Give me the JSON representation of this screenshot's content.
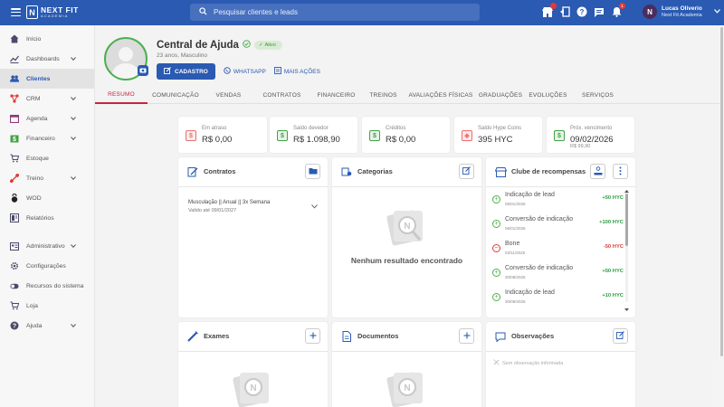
{
  "topbar": {
    "brand_line1": "NEXT FIT",
    "brand_line2": "ACADEMIA",
    "search_placeholder": "Pesquisar clientes e leads",
    "icons": [
      "store-icon",
      "exit-door-icon",
      "help-icon",
      "chat-icon",
      "bell-icon"
    ],
    "notification_badge": "1",
    "user_initial": "N",
    "user_name": "Lucas Oliverio",
    "user_company": "Next Fit Academia",
    "brand_color": "#2a5ab1"
  },
  "sidebar": {
    "items": [
      {
        "label": "Início",
        "icon": "home-icon",
        "chevron": false,
        "active": false
      },
      {
        "label": "Dashboards",
        "icon": "chart-line-icon",
        "chevron": true,
        "active": false
      },
      {
        "label": "Clientes",
        "icon": "people-icon",
        "chevron": false,
        "active": true
      },
      {
        "label": "CRM",
        "icon": "crm-icon",
        "chevron": true,
        "active": false
      },
      {
        "label": "Agenda",
        "icon": "calendar-icon",
        "chevron": true,
        "active": false
      },
      {
        "label": "Financeiro",
        "icon": "money-icon",
        "chevron": true,
        "active": false
      },
      {
        "label": "Estoque",
        "icon": "cart-icon",
        "chevron": false,
        "active": false
      },
      {
        "label": "Treino",
        "icon": "dumbbell-icon",
        "chevron": true,
        "active": false
      },
      {
        "label": "WOD",
        "icon": "kettlebell-icon",
        "chevron": false,
        "active": false
      },
      {
        "label": "Relatórios",
        "icon": "report-icon",
        "chevron": false,
        "active": false
      }
    ],
    "items2": [
      {
        "label": "Administrativo",
        "icon": "id-card-icon",
        "chevron": true
      },
      {
        "label": "Configurações",
        "icon": "gear-icon",
        "chevron": false
      },
      {
        "label": "Recursos do sistema",
        "icon": "toggle-icon",
        "chevron": false
      },
      {
        "label": "Loja",
        "icon": "cart-icon",
        "chevron": false
      },
      {
        "label": "Ajuda",
        "icon": "help-icon",
        "chevron": true
      }
    ]
  },
  "profile": {
    "name": "Central de Ajuda",
    "status": "Ativo",
    "subtitle": "23 anos, Masculino",
    "cadastro_label": "CADASTRO",
    "whatsapp_label": "WHATSAPP",
    "more_label": "MAIS AÇÕES"
  },
  "tabs": [
    "RESUMO",
    "COMUNICAÇÃO",
    "VENDAS",
    "CONTRATOS",
    "FINANCEIRO",
    "TREINOS",
    "AVALIAÇÕES FÍSICAS",
    "GRADUAÇÕES",
    "EVOLUÇÕES",
    "SERVIÇOS"
  ],
  "summary": [
    {
      "label": "Em atraso",
      "value": "R$ 0,00",
      "extra": "",
      "color": "#e57373",
      "bg": "#fdeaea"
    },
    {
      "label": "Saldo devedor",
      "value": "R$ 1.098,90",
      "extra": "",
      "color": "#43a047",
      "bg": "#e6f4e7"
    },
    {
      "label": "Créditos",
      "value": "R$ 0,00",
      "extra": "",
      "color": "#43a047",
      "bg": "#e6f4e7"
    },
    {
      "label": "Saldo Hype Coins",
      "value": "395 HYC",
      "extra": "",
      "color": "#ef6c6c",
      "bg": "#fde9e9"
    },
    {
      "label": "Próx. vencimento",
      "value": "09/02/2026",
      "extra": "R$ 99,90",
      "color": "#43a047",
      "bg": "#e6f4e7"
    }
  ],
  "contratos": {
    "title": "Contratos",
    "name": "Musculação || Anual || 3x Semana",
    "valid": "Valido até 09/01/2027"
  },
  "categorias": {
    "title": "Categorias",
    "empty": "Nenhum resultado encontrado"
  },
  "clube": {
    "title": "Clube de recompensas",
    "items": [
      {
        "title": "Indicação de lead",
        "date": "06/01/2026",
        "points": "+50 HYC",
        "positive": true
      },
      {
        "title": "Conversão de indicação",
        "date": "06/01/2026",
        "points": "+100 HYC",
        "positive": true
      },
      {
        "title": "Bone",
        "date": "03/11/2025",
        "points": "-50 HYC",
        "positive": false
      },
      {
        "title": "Conversão de indicação",
        "date": "30/08/2025",
        "points": "+50 HYC",
        "positive": true
      },
      {
        "title": "Indicação de lead",
        "date": "30/08/2025",
        "points": "+10 HYC",
        "positive": true
      }
    ]
  },
  "exames": {
    "title": "Exames"
  },
  "documentos": {
    "title": "Documentos"
  },
  "observacoes": {
    "title": "Observações",
    "empty": "Sem observação informada"
  }
}
